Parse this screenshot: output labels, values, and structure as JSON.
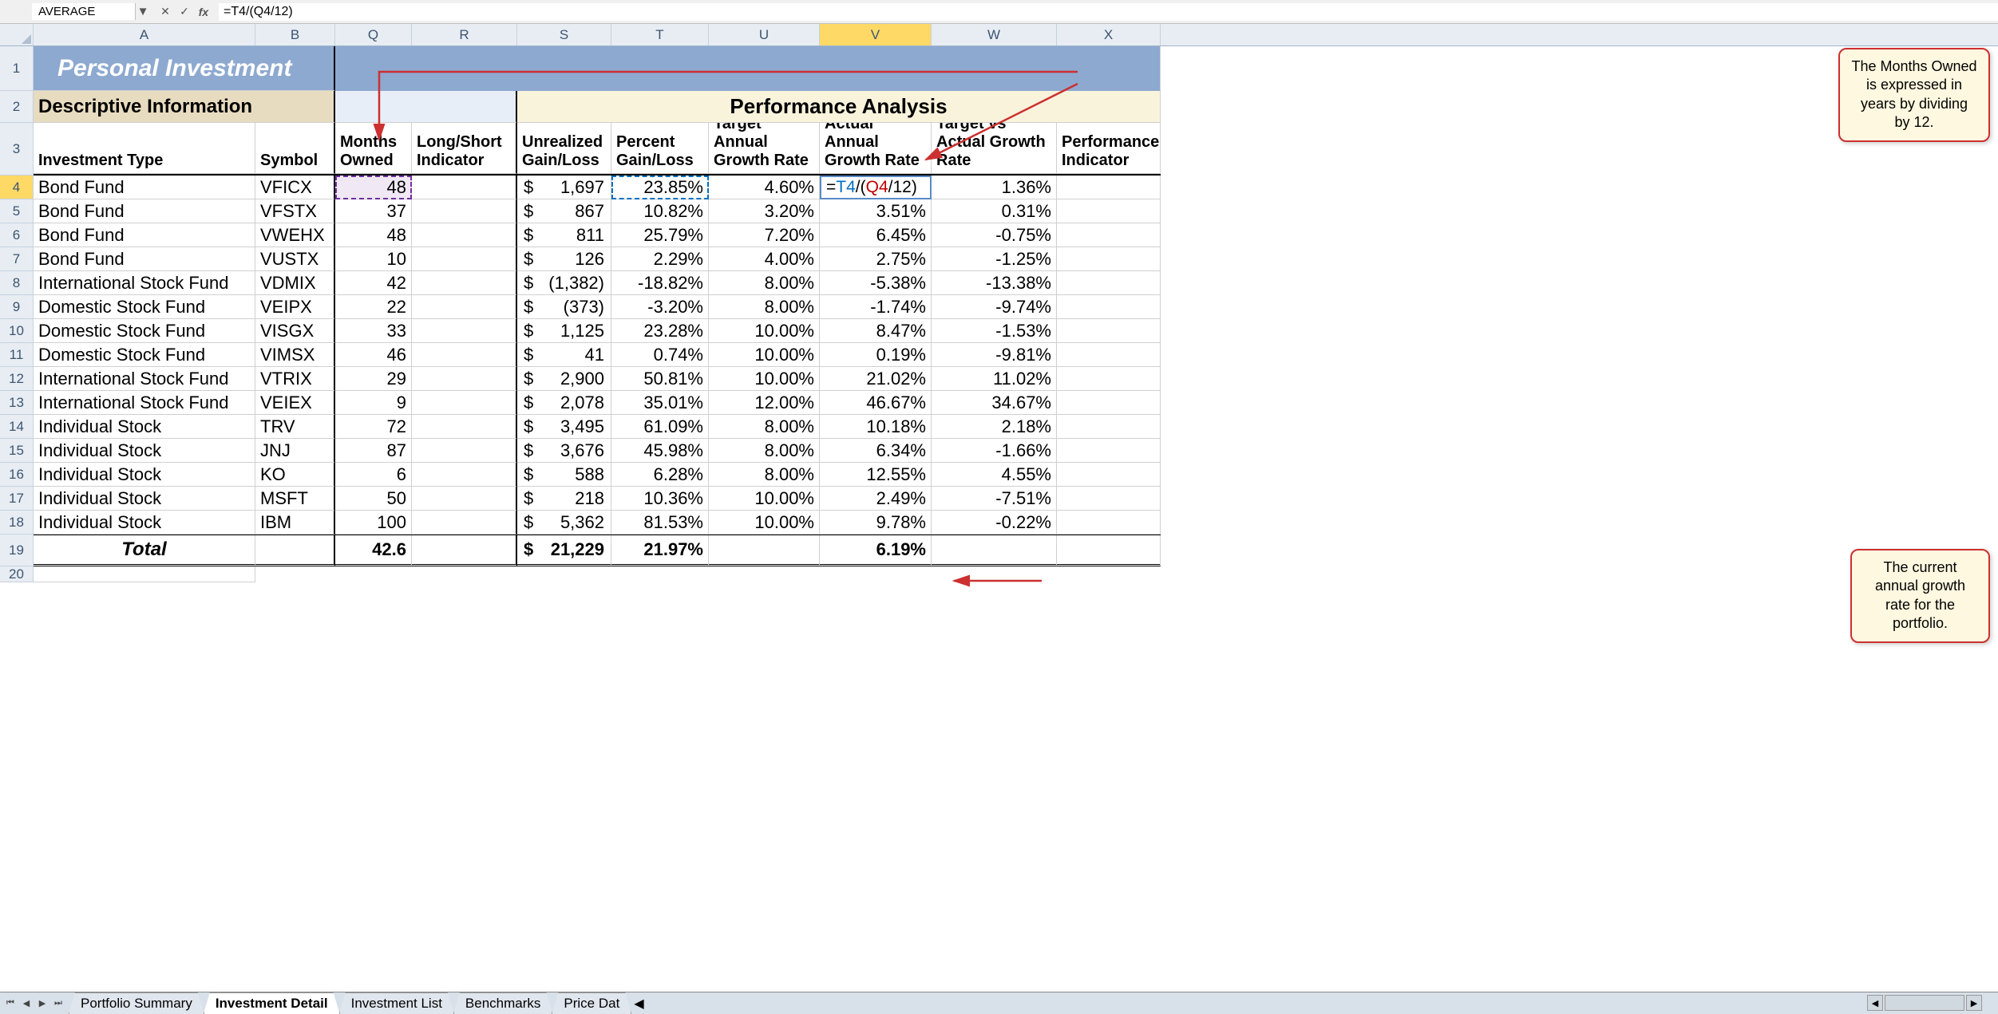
{
  "formula_bar": {
    "name_box": "AVERAGE",
    "formula": "=T4/(Q4/12)"
  },
  "columns": [
    "A",
    "B",
    "Q",
    "R",
    "S",
    "T",
    "U",
    "V",
    "W",
    "X"
  ],
  "active_col": "V",
  "active_row": "4",
  "row_numbers": [
    "1",
    "2",
    "3",
    "4",
    "5",
    "6",
    "7",
    "8",
    "9",
    "10",
    "11",
    "12",
    "13",
    "14",
    "15",
    "16",
    "17",
    "18",
    "19",
    "20"
  ],
  "title": "Personal Investment",
  "section_left": "Descriptive Information",
  "section_right": "Performance Analysis",
  "headers": {
    "A": "Investment Type",
    "B": "Symbol",
    "Q": "Months Owned",
    "R": "Long/Short Indicator",
    "S": "Unrealized Gain/Loss",
    "T": "Percent Gain/Loss",
    "U": "Target Annual Growth Rate",
    "V": "Actual Annual Growth Rate",
    "W": "Target vs Actual Growth Rate",
    "X": "Performance Indicator"
  },
  "rows": [
    {
      "A": "Bond Fund",
      "B": "VFICX",
      "Q": "48",
      "S": "1,697",
      "T": "23.85%",
      "U": "4.60%",
      "V": "=T4/(Q4/12)",
      "W": "1.36%"
    },
    {
      "A": "Bond Fund",
      "B": "VFSTX",
      "Q": "37",
      "S": "867",
      "T": "10.82%",
      "U": "3.20%",
      "V": "3.51%",
      "W": "0.31%"
    },
    {
      "A": "Bond Fund",
      "B": "VWEHX",
      "Q": "48",
      "S": "811",
      "T": "25.79%",
      "U": "7.20%",
      "V": "6.45%",
      "W": "-0.75%"
    },
    {
      "A": "Bond Fund",
      "B": "VUSTX",
      "Q": "10",
      "S": "126",
      "T": "2.29%",
      "U": "4.00%",
      "V": "2.75%",
      "W": "-1.25%"
    },
    {
      "A": "International Stock Fund",
      "B": "VDMIX",
      "Q": "42",
      "S": "(1,382)",
      "T": "-18.82%",
      "U": "8.00%",
      "V": "-5.38%",
      "W": "-13.38%"
    },
    {
      "A": "Domestic Stock Fund",
      "B": "VEIPX",
      "Q": "22",
      "S": "(373)",
      "T": "-3.20%",
      "U": "8.00%",
      "V": "-1.74%",
      "W": "-9.74%"
    },
    {
      "A": "Domestic Stock Fund",
      "B": "VISGX",
      "Q": "33",
      "S": "1,125",
      "T": "23.28%",
      "U": "10.00%",
      "V": "8.47%",
      "W": "-1.53%"
    },
    {
      "A": "Domestic Stock Fund",
      "B": "VIMSX",
      "Q": "46",
      "S": "41",
      "T": "0.74%",
      "U": "10.00%",
      "V": "0.19%",
      "W": "-9.81%"
    },
    {
      "A": "International Stock Fund",
      "B": "VTRIX",
      "Q": "29",
      "S": "2,900",
      "T": "50.81%",
      "U": "10.00%",
      "V": "21.02%",
      "W": "11.02%"
    },
    {
      "A": "International Stock Fund",
      "B": "VEIEX",
      "Q": "9",
      "S": "2,078",
      "T": "35.01%",
      "U": "12.00%",
      "V": "46.67%",
      "W": "34.67%"
    },
    {
      "A": "Individual Stock",
      "B": "TRV",
      "Q": "72",
      "S": "3,495",
      "T": "61.09%",
      "U": "8.00%",
      "V": "10.18%",
      "W": "2.18%"
    },
    {
      "A": "Individual Stock",
      "B": "JNJ",
      "Q": "87",
      "S": "3,676",
      "T": "45.98%",
      "U": "8.00%",
      "V": "6.34%",
      "W": "-1.66%"
    },
    {
      "A": "Individual Stock",
      "B": "KO",
      "Q": "6",
      "S": "588",
      "T": "6.28%",
      "U": "8.00%",
      "V": "12.55%",
      "W": "4.55%"
    },
    {
      "A": "Individual Stock",
      "B": "MSFT",
      "Q": "50",
      "S": "218",
      "T": "10.36%",
      "U": "10.00%",
      "V": "2.49%",
      "W": "-7.51%"
    },
    {
      "A": "Individual Stock",
      "B": "IBM",
      "Q": "100",
      "S": "5,362",
      "T": "81.53%",
      "U": "10.00%",
      "V": "9.78%",
      "W": "-0.22%"
    }
  ],
  "total": {
    "label": "Total",
    "Q": "42.6",
    "S": "21,229",
    "T": "21.97%",
    "V": "6.19%"
  },
  "sheet_tabs": [
    "Portfolio Summary",
    "Investment Detail",
    "Investment List",
    "Benchmarks",
    "Price Dat"
  ],
  "active_tab": "Investment Detail",
  "callout1": "The Months Owned is expressed in years by dividing by 12.",
  "callout2": "The current annual growth rate for the portfolio.",
  "currency_sym": "$"
}
